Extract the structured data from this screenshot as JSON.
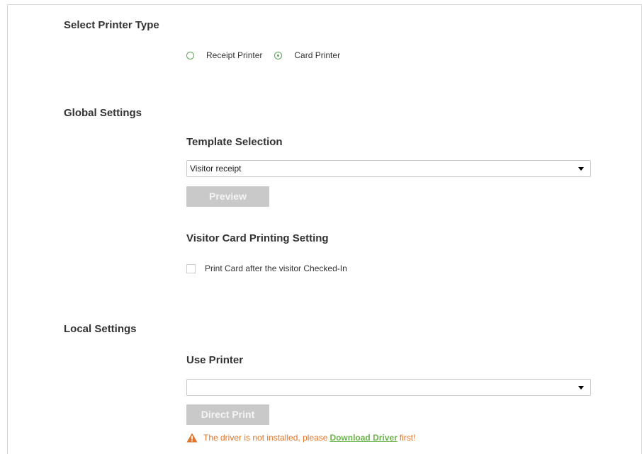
{
  "sections": {
    "printer_type": {
      "title": "Select Printer Type",
      "options": [
        {
          "label": "Receipt Printer",
          "selected": false
        },
        {
          "label": "Card Printer",
          "selected": true
        }
      ]
    },
    "global": {
      "title": "Global Settings",
      "template_selection": {
        "title": "Template Selection",
        "value": "Visitor receipt",
        "preview_label": "Preview"
      },
      "card_printing": {
        "title": "Visitor Card Printing Setting",
        "checkbox_label": "Print Card after the visitor Checked-In",
        "checked": false
      }
    },
    "local": {
      "title": "Local Settings",
      "use_printer": {
        "title": "Use Printer",
        "value": "",
        "direct_print_label": "Direct Print"
      },
      "warning": {
        "prefix": "The driver is not installed, please",
        "link": "Download Driver",
        "suffix": "first!"
      }
    }
  },
  "colors": {
    "accent_green": "#5aa65a",
    "warning_orange": "#e0752b",
    "link_green": "#6bb34a",
    "button_disabled": "#c9c9c9"
  },
  "icons": {
    "select_arrow": "chevron-down-icon",
    "warning": "warning-triangle-icon"
  }
}
